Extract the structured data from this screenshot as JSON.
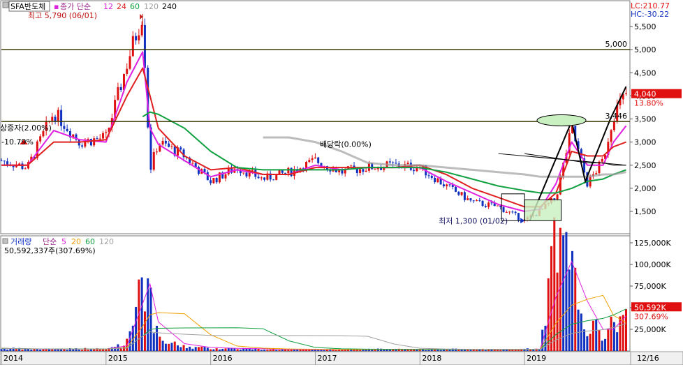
{
  "ticker": {
    "label": "SFA반도체",
    "price_ma_label": "종가 단순",
    "ma_periods": [
      "12",
      "24",
      "60",
      "120",
      "240"
    ],
    "ma_colors": [
      "#e020e0",
      "#e02020",
      "#10a040",
      "#a0a0a0",
      "#000000"
    ]
  },
  "top_right": {
    "lc": "LC:210.77",
    "hc": "HC:-30.22"
  },
  "current": {
    "price": "4,040",
    "change": "13.80%",
    "ref_price": "3,446"
  },
  "annotations": {
    "high": "최고 5,790 (06/01)",
    "low": "최저 1,300 (01/02)",
    "capital_increase": "상증자(2.00%)",
    "capital_pct": "-10.79%",
    "dividend": "배당락(0.00%)",
    "level_5000": "5,000"
  },
  "volume": {
    "label": "거래량",
    "ma_label": "단순",
    "ma_periods": [
      "5",
      "20",
      "60",
      "120"
    ],
    "ma_colors": [
      "#e020e0",
      "#f0a000",
      "#10a040",
      "#a0a0a0"
    ],
    "current_value": "50,592,337주(307.69%)",
    "axis_value": "50,592K",
    "axis_pct": "307.69%"
  },
  "axes": {
    "price_ticks": [
      "5,500",
      "5,000",
      "4,500",
      "4,000",
      "3,500",
      "3,000",
      "2,500",
      "2,000",
      "1,500"
    ],
    "volume_ticks": [
      "125,000K",
      "100,000K",
      "75,000K",
      "50,000K",
      "25,000K"
    ],
    "x_ticks": [
      "2014",
      "2015",
      "2016",
      "2017",
      "2018",
      "2019"
    ],
    "x_end": "12/16"
  },
  "colors": {
    "up": "#e01010",
    "down": "#1030c0",
    "current_bg": "#e01010"
  },
  "chart_data": {
    "type": "line",
    "title": "SFA반도체",
    "xlabel": "",
    "ylabel": "",
    "price_ylim": [
      1100,
      5800
    ],
    "volume_ylim": [
      0,
      135000
    ],
    "x": [
      2014.0,
      2014.25,
      2014.5,
      2014.75,
      2015.0,
      2015.2,
      2015.35,
      2015.42,
      2015.5,
      2015.75,
      2016.0,
      2016.25,
      2016.5,
      2016.75,
      2017.0,
      2017.25,
      2017.5,
      2017.75,
      2018.0,
      2018.25,
      2018.5,
      2018.75,
      2019.0,
      2019.15,
      2019.3,
      2019.45,
      2019.6,
      2019.75,
      2019.85,
      2019.97
    ],
    "series": [
      {
        "name": "종가",
        "values": [
          2600,
          2450,
          3650,
          3000,
          3100,
          4700,
          5790,
          2400,
          3000,
          2700,
          2150,
          2450,
          2200,
          2350,
          2600,
          2350,
          2450,
          2500,
          2450,
          2050,
          1700,
          1600,
          1300,
          1500,
          1800,
          3300,
          2100,
          2600,
          3600,
          4040
        ]
      },
      {
        "name": "12",
        "values": [
          2500,
          2500,
          3250,
          3050,
          3000,
          4300,
          4950,
          3300,
          2950,
          2600,
          2250,
          2400,
          2300,
          2300,
          2500,
          2400,
          2450,
          2450,
          2450,
          2150,
          1900,
          1650,
          1500,
          1550,
          2100,
          3000,
          2500,
          2500,
          3000,
          3350
        ]
      },
      {
        "name": "24",
        "values": [
          2500,
          2500,
          3000,
          3000,
          3050,
          4000,
          4600,
          4000,
          3300,
          2700,
          2400,
          2450,
          2300,
          2300,
          2450,
          2450,
          2450,
          2450,
          2500,
          2300,
          2000,
          1800,
          1600,
          1600,
          1900,
          2800,
          2700,
          2700,
          2900,
          3000
        ]
      },
      {
        "name": "60",
        "values": [
          null,
          null,
          null,
          null,
          null,
          null,
          3550,
          3650,
          3600,
          3300,
          2800,
          2450,
          2400,
          2400,
          2400,
          2400,
          2450,
          2450,
          2450,
          2350,
          2200,
          2050,
          1950,
          1900,
          1900,
          2000,
          2150,
          2200,
          2300,
          2400
        ]
      },
      {
        "name": "120",
        "values": [
          null,
          null,
          null,
          null,
          null,
          null,
          null,
          null,
          null,
          null,
          null,
          null,
          3100,
          3100,
          3000,
          2800,
          2550,
          2500,
          2500,
          2450,
          2400,
          2350,
          2300,
          2250,
          2250,
          2250,
          2250,
          2300,
          2300,
          2350
        ]
      },
      {
        "name": "240",
        "values": [
          null,
          null,
          null,
          null,
          null,
          null,
          null,
          null,
          null,
          null,
          null,
          null,
          null,
          null,
          null,
          null,
          null,
          null,
          null,
          null,
          null,
          null,
          2750,
          2700,
          2650,
          2600,
          2550,
          2550,
          2500,
          2500
        ]
      }
    ],
    "volume_series": [
      {
        "name": "거래량",
        "values": [
          3000,
          2000,
          2000,
          2500,
          2000,
          10000,
          100000,
          55000,
          12000,
          5000,
          3000,
          3000,
          2000,
          1500,
          1500,
          1500,
          2000,
          2000,
          1500,
          2000,
          2000,
          1500,
          2000,
          2500,
          122000,
          85000,
          30000,
          20000,
          30000,
          50592
        ]
      }
    ],
    "annotations": [
      "최고 5,790 (06/01)",
      "최저 1,300 (01/02)",
      "3,446",
      "5,000"
    ]
  }
}
